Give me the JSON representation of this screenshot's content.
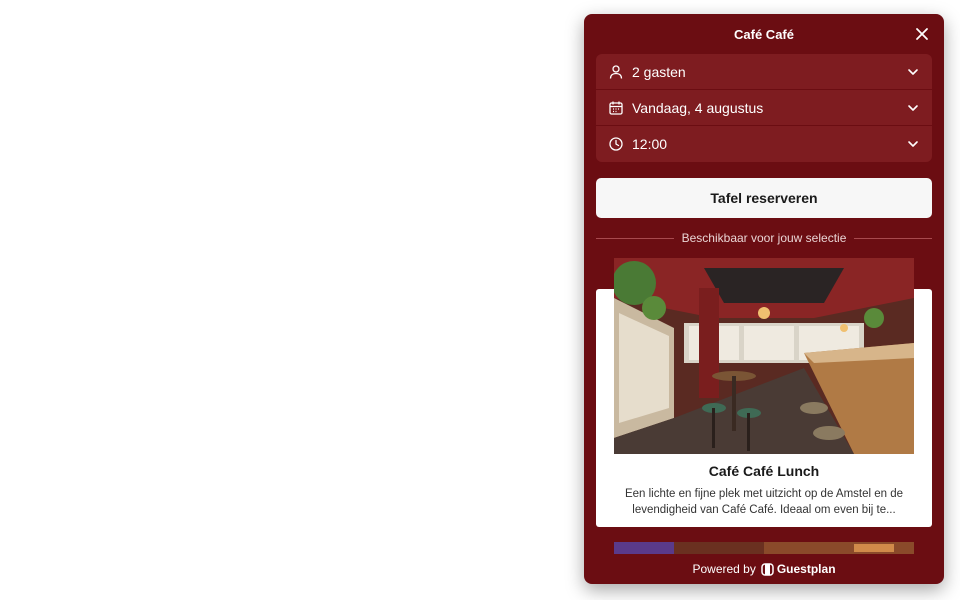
{
  "widget": {
    "title": "Café Café",
    "close_icon": "close-icon"
  },
  "selectors": [
    {
      "icon": "person-icon",
      "value": "2 gasten"
    },
    {
      "icon": "calendar-icon",
      "value": "Vandaag, 4 augustus"
    },
    {
      "icon": "clock-icon",
      "value": "12:00"
    }
  ],
  "reserve_button": "Tafel reserveren",
  "availability_label": "Beschikbaar voor jouw selectie",
  "offers": [
    {
      "title": "Café Café Lunch",
      "description": "Een lichte en fijne plek met uitzicht op de Amstel en de levendigheid van Café Café. Ideaal om even bij te..."
    }
  ],
  "footer": {
    "powered_by": "Powered by",
    "brand": "Guestplan"
  },
  "colors": {
    "panel": "#6b0d12",
    "selector_row": "#7e1c20",
    "button": "#f7f7f7"
  }
}
